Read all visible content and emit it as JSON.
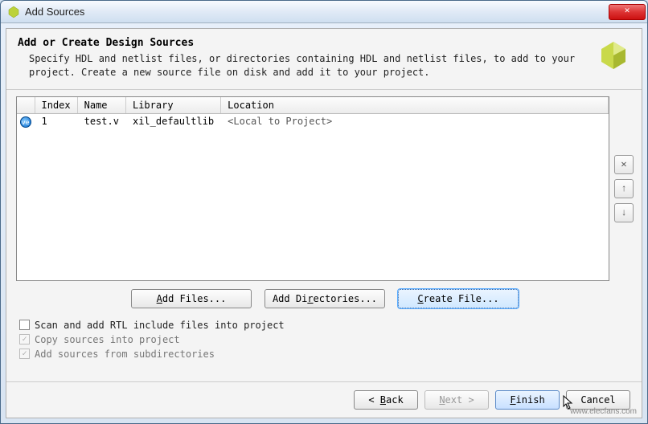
{
  "window": {
    "title": "Add Sources",
    "close_symbol": "✕"
  },
  "header": {
    "title": "Add or Create Design Sources",
    "description": "Specify HDL and netlist files, or directories containing HDL and netlist files, to add to your project. Create a new source file on disk and add it to your project."
  },
  "table": {
    "columns": {
      "index": "Index",
      "name": "Name",
      "library": "Library",
      "location": "Location"
    },
    "rows": [
      {
        "icon": "ve",
        "index": "1",
        "name": "test.v",
        "library": "xil_defaultlib",
        "location": "<Local to Project>"
      }
    ]
  },
  "side_buttons": {
    "remove": "✕",
    "up": "↑",
    "down": "↓"
  },
  "buttons": {
    "add_files": "Add Files...",
    "add_dirs": "Add Directories...",
    "create_file": "Create File..."
  },
  "checkboxes": {
    "scan_rtl": {
      "label": "Scan and add RTL include files into project",
      "checked": false,
      "enabled": true
    },
    "copy_sources": {
      "label": "Copy sources into project",
      "checked": true,
      "enabled": false
    },
    "add_subdirs": {
      "label": "Add sources from subdirectories",
      "checked": true,
      "enabled": false
    }
  },
  "footer": {
    "back": "Back",
    "next": "Next",
    "finish": "Finish",
    "cancel": "Cancel"
  },
  "watermark": "www.elecfans.com"
}
